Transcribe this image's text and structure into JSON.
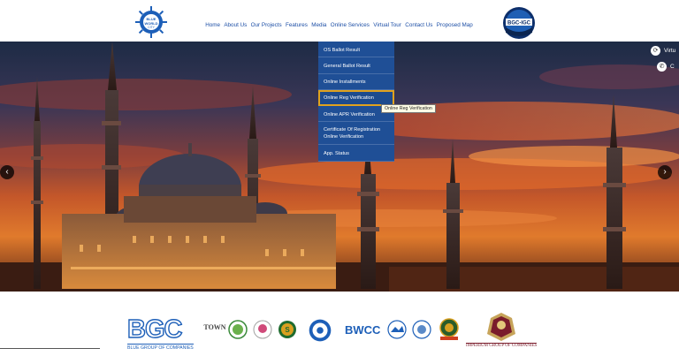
{
  "header": {
    "logo_left_text": "BLUE WORLD CITY",
    "logo_right_text": "BGC-IGC",
    "nav": [
      "Home",
      "About Us",
      "Our Projects",
      "Features",
      "Media",
      "Online Services",
      "Virtual Tour",
      "Contact Us",
      "Proposed Map"
    ]
  },
  "hero": {
    "side_virtual_label": "Virtu",
    "side_call_label": "C"
  },
  "dropdown": {
    "items": [
      "OS Ballot Result",
      "General Ballot Result",
      "Online Installments",
      "Online Reg Verification",
      "Online APR Verification",
      "Certificate Of Registration Online Verification",
      "App. Status"
    ],
    "active_index": 3,
    "tooltip": "Online Reg Verification"
  },
  "footer": {
    "bgc_big": "BGC",
    "bgc_small": "BLUE GROUP OF COMPANIES",
    "town_text": "TOWN",
    "imperium_text": "IMPERIUM GROUP OF COMPANIES",
    "bwcc_text": "BWCC"
  },
  "colors": {
    "nav_blue": "#1d4fa6",
    "dropdown_bg": "#1f4f96",
    "active_outline": "#e0a21e"
  }
}
